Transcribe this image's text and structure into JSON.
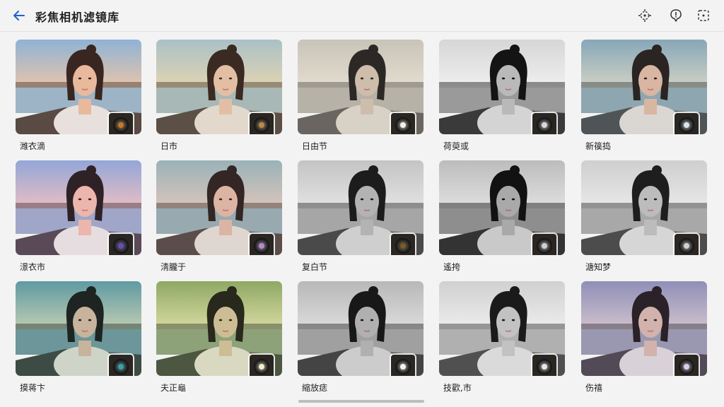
{
  "header": {
    "title": "彩焦相机滤镜库"
  },
  "icons": {
    "back": "arrow-left-icon",
    "focus": "focus-icon",
    "comment": "comment-alert-icon",
    "select": "dashed-select-icon"
  },
  "filters": [
    {
      "label": "潍衣滴",
      "tone": "warm-sunset",
      "lens": "#c27a2a"
    },
    {
      "label": "日市",
      "tone": "soft-vintage",
      "lens": "#b88b45"
    },
    {
      "label": "日由节",
      "tone": "faded-sepia",
      "lens": "#f3f0e6"
    },
    {
      "label": "荷萸或",
      "tone": "bw-contrast",
      "lens": "#d8d8d8"
    },
    {
      "label": "新篌捣",
      "tone": "cool-teal",
      "lens": "#d9e6ea"
    },
    {
      "label": "澋衣市",
      "tone": "pastel-pink",
      "lens": "#6a4bb0"
    },
    {
      "label": "淸朧于",
      "tone": "muted-mauve",
      "lens": "#b48ac9"
    },
    {
      "label": "复白节",
      "tone": "bw-soft",
      "lens": "#7a5a2a"
    },
    {
      "label": "遙挎",
      "tone": "bw-dark",
      "lens": "#cfcfcf"
    },
    {
      "label": "溏知梦",
      "tone": "bw-silver",
      "lens": "#d0d0d0"
    },
    {
      "label": "摸蒋卞",
      "tone": "teal-forest",
      "lens": "#3aa0a8"
    },
    {
      "label": "夫正龜",
      "tone": "olive-green",
      "lens": "#f1ecc8"
    },
    {
      "label": "縮放痣",
      "tone": "bw-grey",
      "lens": "#f2f2f2"
    },
    {
      "label": "技歡,市",
      "tone": "bw-light",
      "lens": "#e6e6e6"
    },
    {
      "label": "伤禧",
      "tone": "lavender",
      "lens": "#d8d0e8"
    }
  ],
  "colors": {
    "background": "#f3f3f3",
    "accent": "#2a6fdb"
  }
}
